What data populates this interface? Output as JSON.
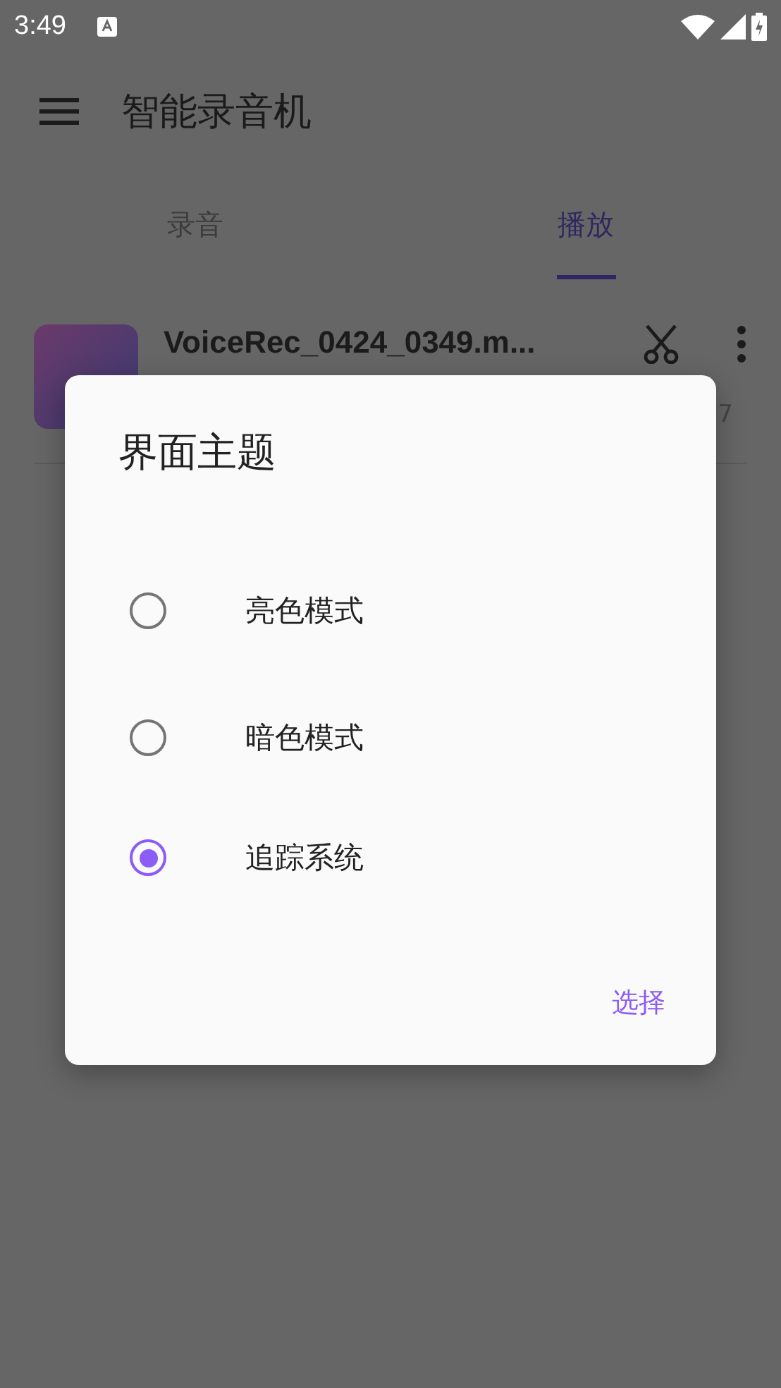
{
  "status_bar": {
    "time": "3:49"
  },
  "app_bar": {
    "title": "智能录音机"
  },
  "tabs": [
    {
      "label": "录音",
      "selected": false
    },
    {
      "label": "播放",
      "selected": true
    }
  ],
  "recordings": [
    {
      "name": "VoiceRec_0424_0349.m...",
      "detail": "7"
    }
  ],
  "dialog": {
    "title": "界面主题",
    "options": [
      {
        "label": "亮色模式",
        "selected": false
      },
      {
        "label": "暗色模式",
        "selected": false
      },
      {
        "label": "追踪系统",
        "selected": true
      }
    ],
    "button": "选择"
  }
}
